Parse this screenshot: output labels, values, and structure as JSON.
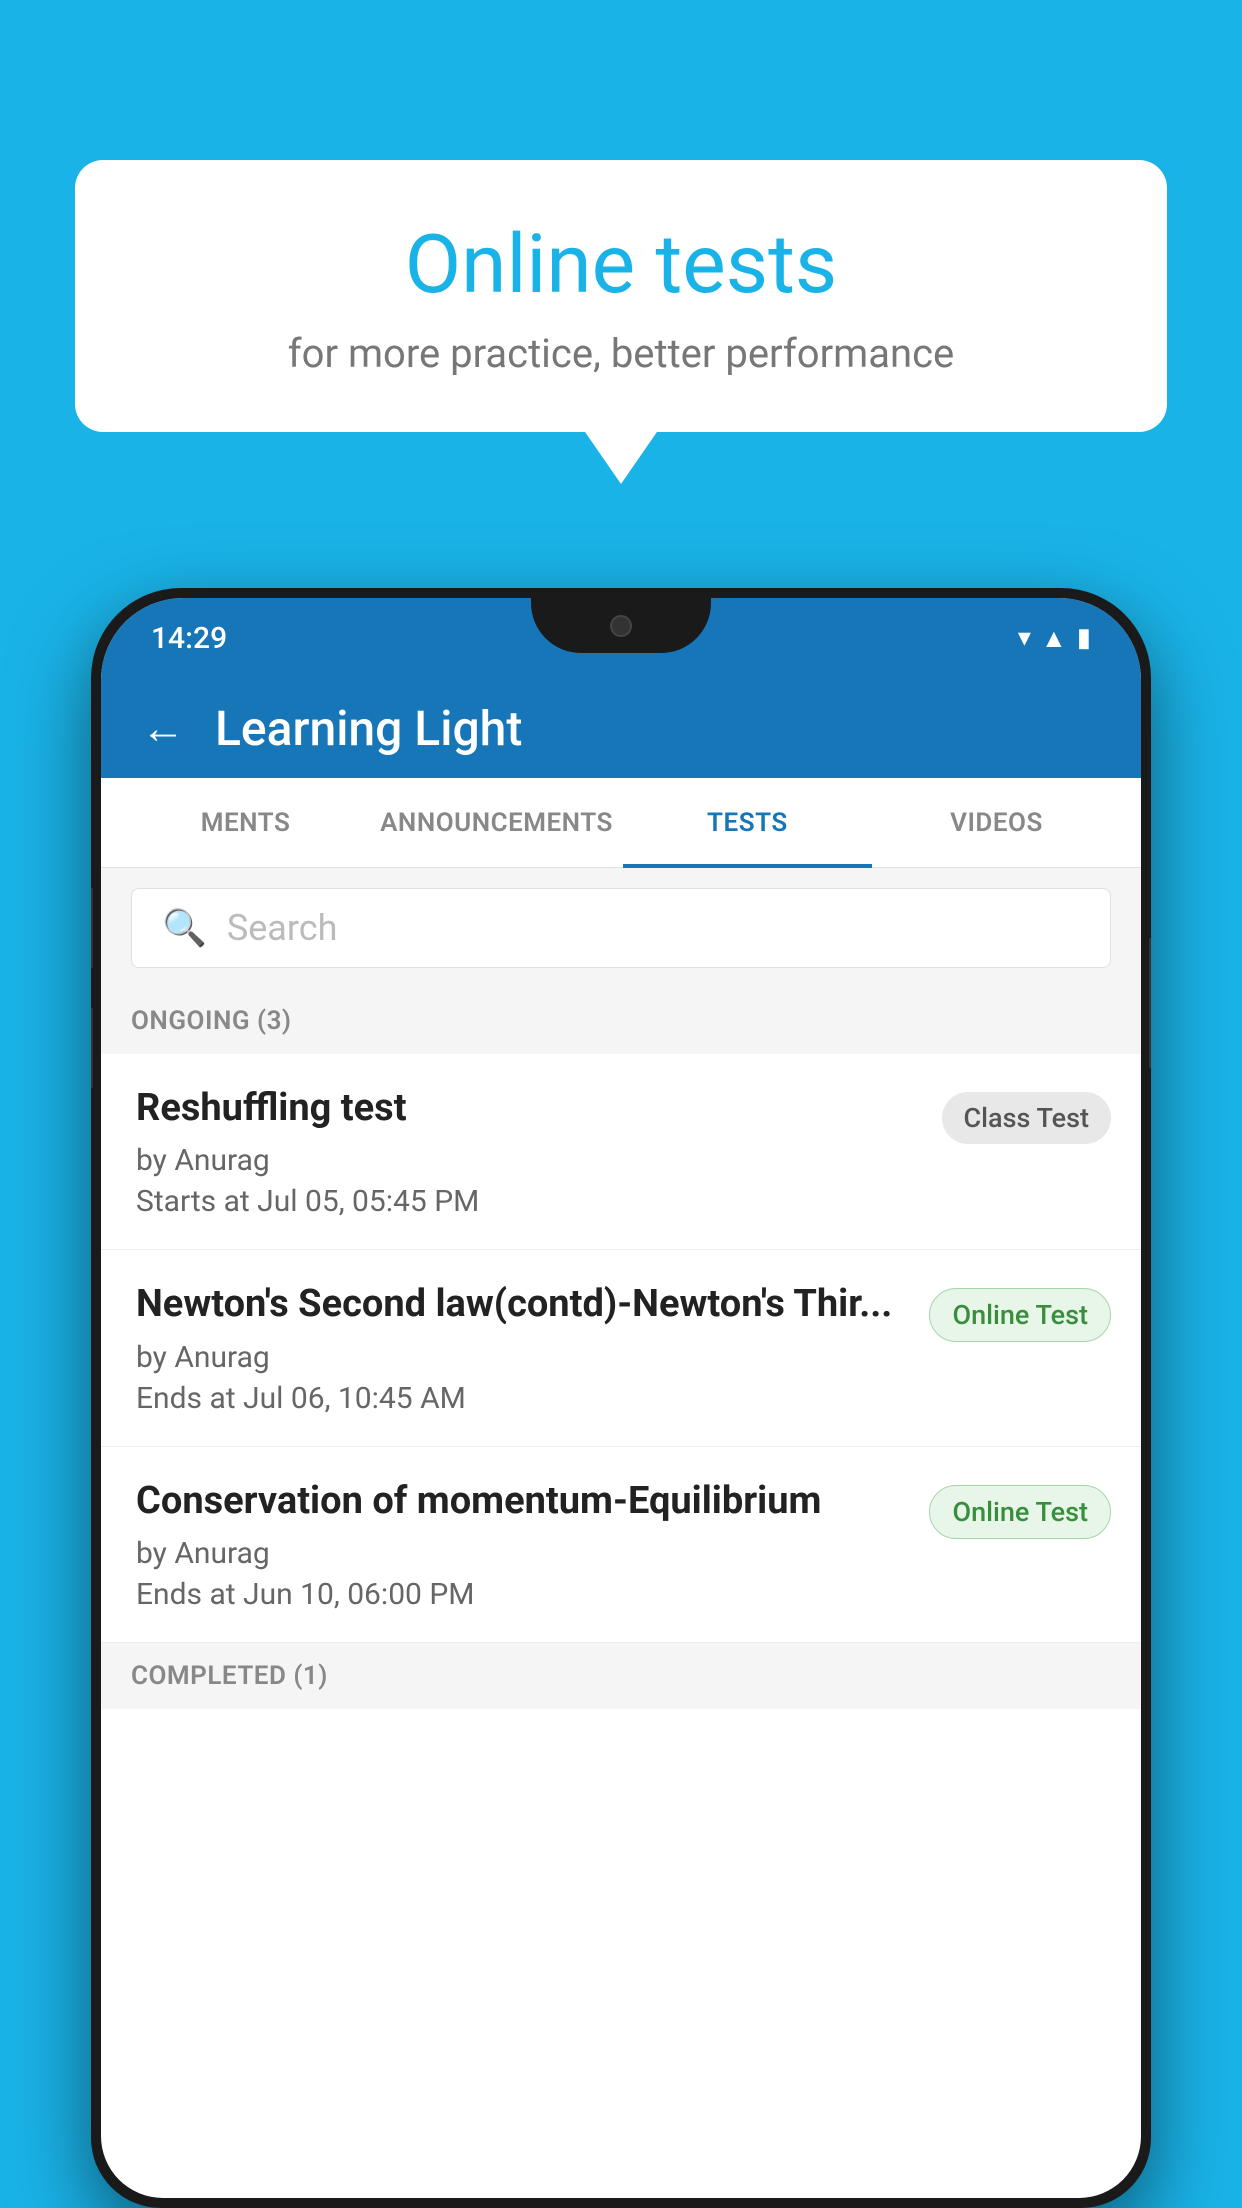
{
  "background_color": "#1ab3e8",
  "bubble": {
    "title": "Online tests",
    "subtitle": "for more practice, better performance"
  },
  "phone": {
    "status_bar": {
      "time": "14:29",
      "icons": [
        "wifi",
        "signal",
        "battery"
      ]
    },
    "app_header": {
      "back_label": "←",
      "title": "Learning Light"
    },
    "tabs": [
      {
        "label": "MENTS",
        "active": false
      },
      {
        "label": "ANNOUNCEMENTS",
        "active": false
      },
      {
        "label": "TESTS",
        "active": true
      },
      {
        "label": "VIDEOS",
        "active": false
      }
    ],
    "search": {
      "placeholder": "Search"
    },
    "sections": [
      {
        "label": "ONGOING (3)",
        "tests": [
          {
            "title": "Reshuffling test",
            "by": "by Anurag",
            "time": "Starts at  Jul 05, 05:45 PM",
            "badge": "Class Test",
            "badge_type": "class"
          },
          {
            "title": "Newton's Second law(contd)-Newton's Thir...",
            "by": "by Anurag",
            "time": "Ends at  Jul 06, 10:45 AM",
            "badge": "Online Test",
            "badge_type": "online"
          },
          {
            "title": "Conservation of momentum-Equilibrium",
            "by": "by Anurag",
            "time": "Ends at  Jun 10, 06:00 PM",
            "badge": "Online Test",
            "badge_type": "online"
          }
        ]
      },
      {
        "label": "COMPLETED (1)",
        "tests": []
      }
    ]
  }
}
